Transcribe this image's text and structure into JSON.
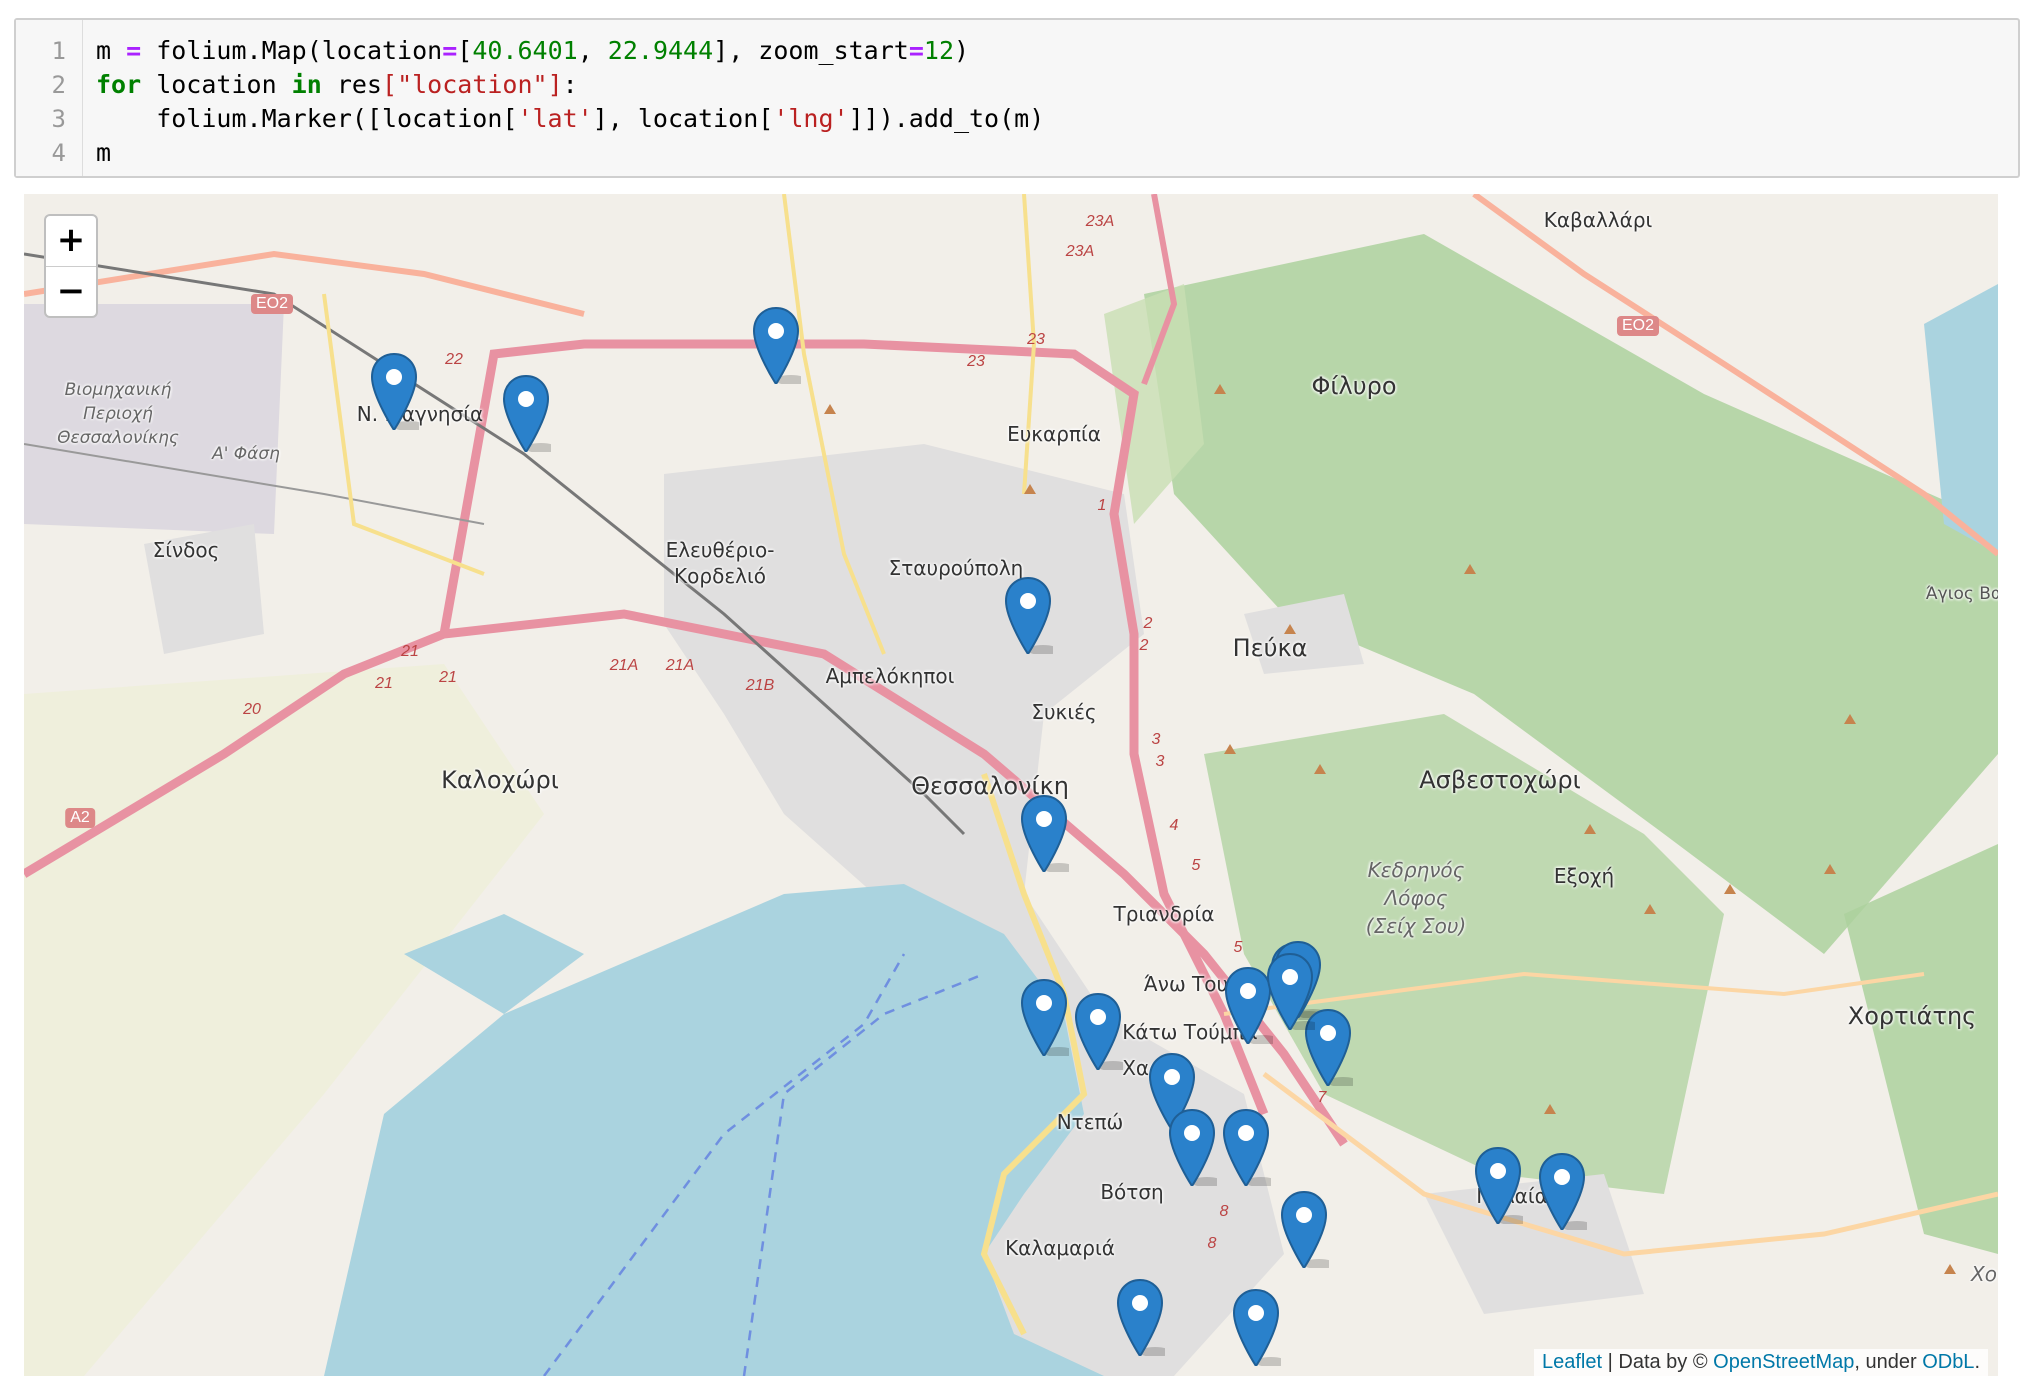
{
  "code_cell": {
    "line_numbers": [
      "1",
      "2",
      "3",
      "4"
    ],
    "lines": [
      [
        [
          "m ",
          ""
        ],
        [
          "=",
          "op"
        ],
        [
          " folium.Map(location",
          ""
        ],
        [
          "=",
          "op"
        ],
        [
          "[",
          ""
        ],
        [
          "40.6401",
          "num"
        ],
        [
          ", ",
          ""
        ],
        [
          "22.9444",
          "num"
        ],
        [
          "], zoom_start",
          ""
        ],
        [
          "=",
          "op"
        ],
        [
          "12",
          "num"
        ],
        [
          ")",
          ""
        ]
      ],
      [
        [
          "for",
          "kw"
        ],
        [
          " location ",
          ""
        ],
        [
          "in",
          "kw"
        ],
        [
          " res",
          ""
        ],
        [
          "[",
          "str"
        ],
        [
          "\"location\"",
          "str"
        ],
        [
          "]",
          "str"
        ],
        [
          ":",
          ""
        ]
      ],
      [
        [
          "    folium.Marker([location[",
          ""
        ],
        [
          "'lat'",
          "str"
        ],
        [
          "], location[",
          ""
        ],
        [
          "'lng'",
          "str"
        ],
        [
          "]]).add_to(m)",
          ""
        ]
      ],
      [
        [
          "m",
          ""
        ]
      ]
    ]
  },
  "map": {
    "zoom_in_label": "+",
    "zoom_out_label": "−",
    "attribution": {
      "leaflet": "Leaflet",
      "sep": " | Data by © ",
      "osm": "OpenStreetMap",
      "mid": ", under ",
      "odbl": "ODbL",
      "end": "."
    },
    "place_labels": [
      {
        "text": "Ν. Μαγνησία",
        "size": "med"
      },
      {
        "text": "Βιομηχανική",
        "size": "small",
        "style": "it"
      },
      {
        "text": "Περιοχή",
        "size": "small",
        "style": "it"
      },
      {
        "text": "Θεσσαλονίκης",
        "size": "small",
        "style": "it"
      },
      {
        "text": "Α' Φάση",
        "size": "small",
        "style": "it"
      },
      {
        "text": "Σίνδος",
        "size": "med"
      },
      {
        "text": "Καλοχώρι",
        "size": "big"
      },
      {
        "text": "Ελευθέριο-",
        "size": "med"
      },
      {
        "text": "Κορδελιό",
        "size": "med"
      },
      {
        "text": "Σταυρούπολη",
        "size": "med"
      },
      {
        "text": "Ευκαρπία",
        "size": "med"
      },
      {
        "text": "Αμπελόκηποι",
        "size": "med"
      },
      {
        "text": "Συκιές",
        "size": "med"
      },
      {
        "text": "Θεσσαλονίκη",
        "size": "big"
      },
      {
        "text": "Πεύκα",
        "size": "big"
      },
      {
        "text": "Φίλυρο",
        "size": "big"
      },
      {
        "text": "Καβαλλάρι",
        "size": "med"
      },
      {
        "text": "Ασβεστοχώρι",
        "size": "big"
      },
      {
        "text": "Άγιος Βα",
        "size": "small"
      },
      {
        "text": "Κεδρηνός",
        "size": "med",
        "style": "it"
      },
      {
        "text": "Λόφος",
        "size": "med",
        "style": "it"
      },
      {
        "text": "(Σείχ Σου)",
        "size": "med",
        "style": "it"
      },
      {
        "text": "Εξοχή",
        "size": "med"
      },
      {
        "text": "Τριανδρία",
        "size": "med"
      },
      {
        "text": "Άνω Του",
        "size": "med"
      },
      {
        "text": "Κάτω Τούμπα",
        "size": "med"
      },
      {
        "text": "Χαρ",
        "size": "med"
      },
      {
        "text": "Ντεπώ",
        "size": "med"
      },
      {
        "text": "Βότση",
        "size": "med"
      },
      {
        "text": "Καλαμαριά",
        "size": "med"
      },
      {
        "text": "Πυλαία",
        "size": "med"
      },
      {
        "text": "Χορτιάτης",
        "size": "big"
      },
      {
        "text": "Χο",
        "size": "med",
        "style": "it"
      }
    ],
    "road_shields": [
      "ΕΟ2",
      "ΕΟ2",
      "Α2"
    ],
    "road_numbers": [
      "22",
      "23",
      "23",
      "23A",
      "23A",
      "21",
      "21",
      "21",
      "20",
      "21A",
      "21A",
      "21B",
      "1",
      "2",
      "2",
      "3",
      "3",
      "4",
      "5",
      "5",
      "7",
      "8",
      "8"
    ],
    "marker_count": 20,
    "colors": {
      "marker": "#2a81cb",
      "sea": "#aad3df",
      "forest": "#add19e",
      "land": "#f2efe9",
      "urban": "#e0dfdf",
      "motorway": "#e892a2",
      "trunk": "#f9b29c",
      "primary": "#fcd6a4"
    }
  }
}
